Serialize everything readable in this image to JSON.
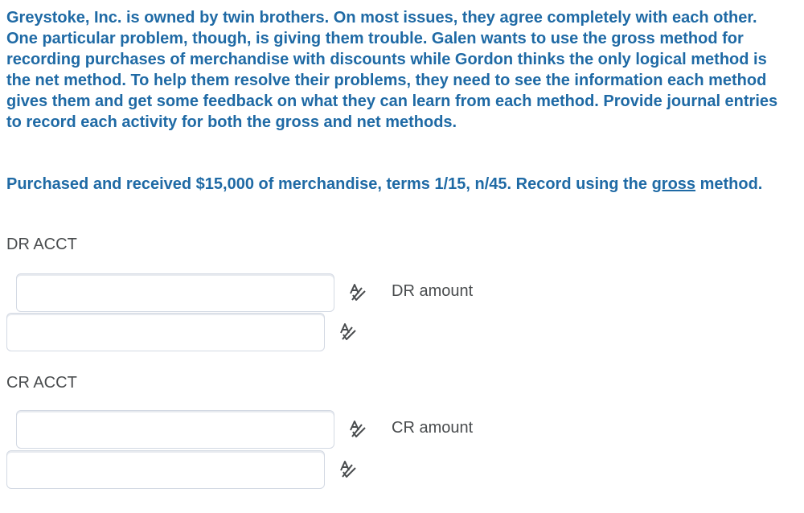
{
  "question": {
    "paragraph": "Greystoke, Inc. is owned by twin brothers. On most issues, they agree completely with each other. One particular problem, though, is giving them trouble. Galen wants to use the gross method for recording purchases of merchandise with discounts while Gordon thinks the only logical method is the net method. To help them resolve their problems, they need to see the information each method gives them and get some feedback on what they can learn from each method. Provide journal entries to record each activity for both the gross and net methods.",
    "instruction_prefix": "Purchased and received $15,000 of merchandise, terms 1/15, n/45.  Record using the ",
    "instruction_emphasis": "gross",
    "instruction_suffix": " method."
  },
  "debit": {
    "section_label": "DR ACCT",
    "account_value": "",
    "amount_label": "DR amount",
    "amount_value": ""
  },
  "credit": {
    "section_label": "CR ACCT",
    "account_value": "",
    "amount_label": "CR amount",
    "amount_value": ""
  },
  "icons": {
    "spell_check": "spell-check-icon"
  },
  "colors": {
    "question_text": "#1f6aa5",
    "label_text": "#494c4e",
    "field_border": "#d3d9e3"
  }
}
